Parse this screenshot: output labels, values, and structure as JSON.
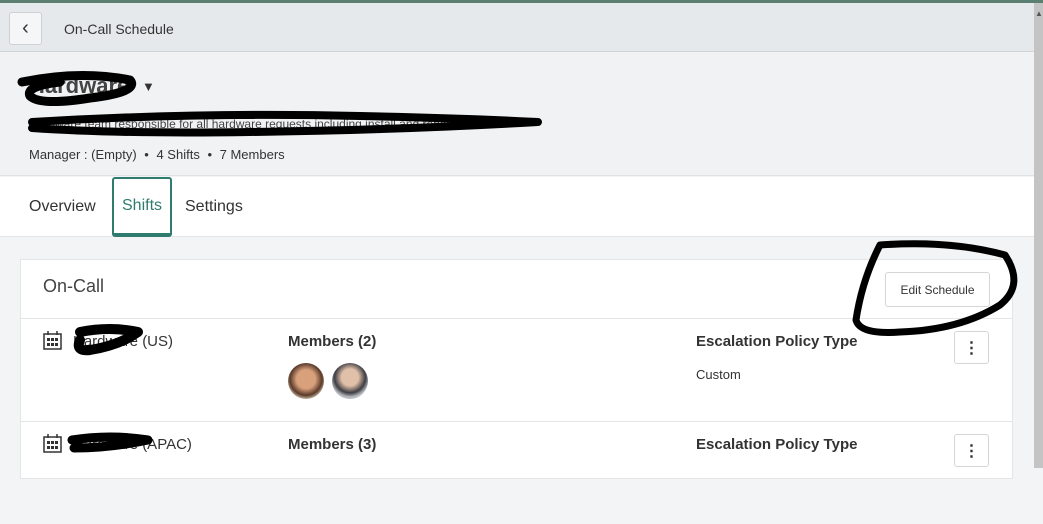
{
  "header": {
    "back_icon": "chevron-left",
    "title": "On-Call Schedule"
  },
  "group": {
    "name": "Hardware",
    "description": "Hardware team responsible for all hardware requests including install and repair",
    "manager": "Manager : (Empty)",
    "shifts": "4 Shifts",
    "members": "7 Members",
    "separator": "•"
  },
  "tabs": [
    {
      "label": "Overview"
    },
    {
      "label": "Shifts",
      "active": true
    },
    {
      "label": "Settings"
    }
  ],
  "card": {
    "title": "On-Call",
    "edit_label": "Edit Schedule",
    "rows": [
      {
        "name": "Hardware (US)",
        "members_label": "Members (2)",
        "esc_label": "Escalation Policy Type",
        "esc_value": "Custom"
      },
      {
        "name": "Hardware (APAC)",
        "members_label": "Members (3)",
        "esc_label": "Escalation Policy Type"
      }
    ]
  },
  "colors": {
    "accent": "#2f7c6e",
    "topline": "#5b7f70"
  }
}
